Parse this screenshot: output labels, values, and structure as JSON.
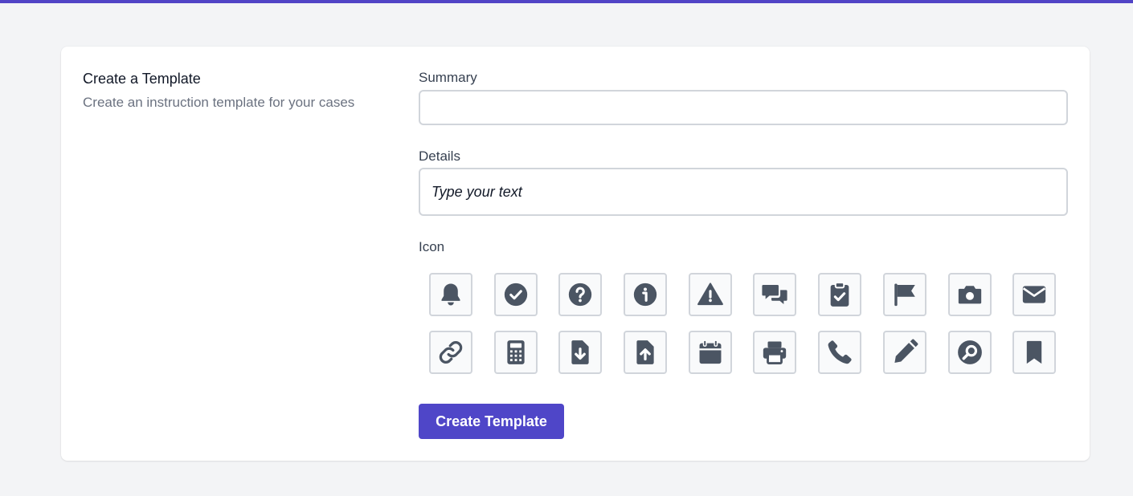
{
  "intro": {
    "title": "Create a Template",
    "subtitle": "Create an instruction template for your cases"
  },
  "form": {
    "summary_label": "Summary",
    "summary_value": "",
    "details_label": "Details",
    "details_placeholder": "Type your text",
    "icon_label": "Icon",
    "submit_label": "Create Template"
  },
  "icons": [
    "bell-icon",
    "check-circle-icon",
    "question-circle-icon",
    "info-circle-icon",
    "warning-icon",
    "chat-bubbles-icon",
    "clipboard-check-icon",
    "flag-icon",
    "camera-icon",
    "envelope-icon",
    "link-icon",
    "calculator-icon",
    "file-download-icon",
    "file-upload-icon",
    "calendar-icon",
    "printer-icon",
    "phone-icon",
    "pencil-icon",
    "search-circle-icon",
    "bookmark-icon"
  ],
  "colors": {
    "accent": "#4f46c8",
    "icon": "#4b5563",
    "border": "#d1d5db",
    "background": "#f3f4f6"
  }
}
